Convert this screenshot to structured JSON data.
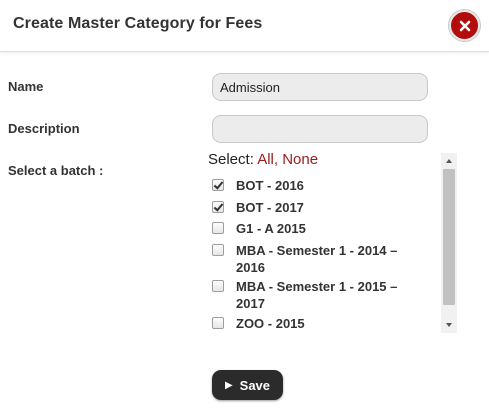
{
  "dialog": {
    "title": "Create Master Category for Fees",
    "close_icon": "close-icon",
    "accent_color": "#b30c0c"
  },
  "form": {
    "name_label": "Name",
    "name_value": "Admission",
    "description_label": "Description",
    "description_value": "",
    "batch_label": "Select a batch :"
  },
  "batch_select": {
    "select_prefix": "Select:",
    "all_label": "All,",
    "none_label": "None",
    "items": [
      {
        "label": "BOT - 2016",
        "checked": true
      },
      {
        "label": "BOT - 2017",
        "checked": true
      },
      {
        "label": "G1 - A 2015",
        "checked": false
      },
      {
        "label": "MBA - Semester 1 - 2014 – 2016",
        "checked": false
      },
      {
        "label": "MBA - Semester 1 - 2015 – 2017",
        "checked": false
      },
      {
        "label": "ZOO - 2015",
        "checked": false
      }
    ]
  },
  "actions": {
    "save_label": "Save",
    "save_icon": "play-icon"
  }
}
